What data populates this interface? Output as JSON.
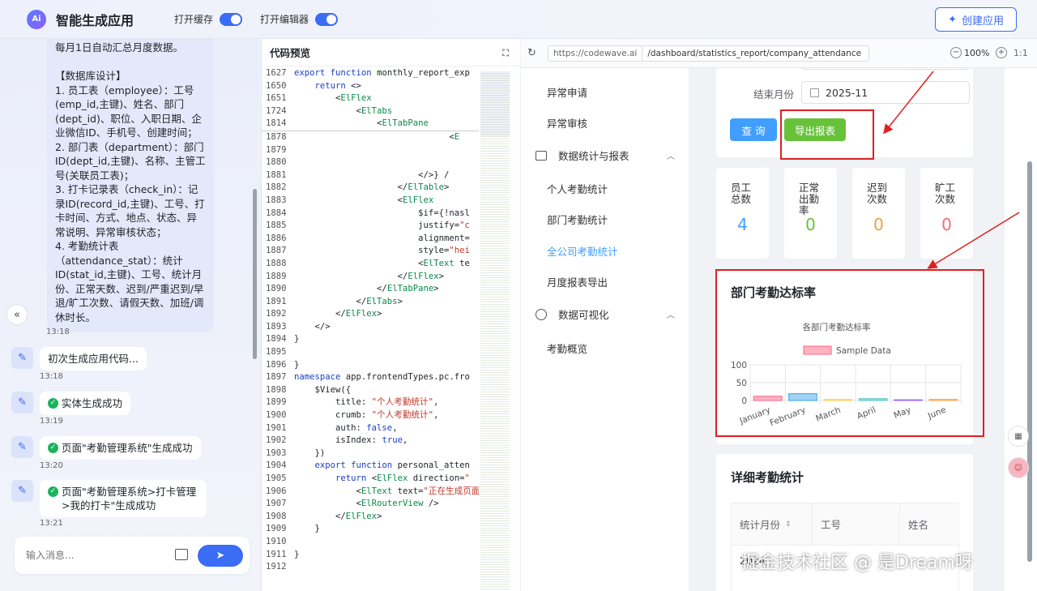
{
  "topbar": {
    "logo_text": "Ai",
    "app_title": "智能生成应用",
    "toggle_cache_label": "打开缓存",
    "toggle_editor_label": "打开编辑器",
    "create_button": "创建应用",
    "accent_color": "#3b6cf6"
  },
  "chat": {
    "first_message": {
      "lines": [
        "每月1日自动汇总月度数据。",
        "",
        "【数据库设计】",
        "1. 员工表（employee）：工号(emp_id,主键)、姓名、部门(dept_id)、职位、入职日期、企业微信ID、手机号、创建时间；",
        "2. 部门表（department）：部门ID(dept_id,主键)、名称、主管工号(关联员工表)；",
        "3. 打卡记录表（check_in）：记录ID(record_id,主键)、工号、打卡时间、方式、地点、状态、异常说明、异常审核状态；",
        "4. 考勤统计表（attendance_stat）：统计ID(stat_id,主键)、工号、统计月份、正常天数、迟到/严重迟到/早退/旷工次数、请假天数、加班/调休时长。"
      ],
      "time": "13:18"
    },
    "logs": [
      {
        "text": "初次生成应用代码...",
        "success": false,
        "time": "13:18"
      },
      {
        "text": "实体生成成功",
        "success": true,
        "time": "13:19"
      },
      {
        "text": "页面\"考勤管理系统\"生成成功",
        "success": true,
        "time": "13:20"
      },
      {
        "text": "页面\"考勤管理系统>打卡管理>我的打卡\"生成成功",
        "success": true,
        "time": "13:21"
      }
    ],
    "input_placeholder": "输入消息..."
  },
  "code": {
    "header": "代码预览",
    "sticky_lines": [
      {
        "n": "1627",
        "segs": [
          [
            "kw",
            "export function "
          ],
          [
            "t",
            "monthly_report_exp"
          ]
        ]
      },
      {
        "n": "1650",
        "segs": [
          [
            "t",
            "    "
          ],
          [
            "kw",
            "return "
          ],
          [
            "t",
            "<>"
          ]
        ]
      },
      {
        "n": "1651",
        "segs": [
          [
            "t",
            "        <"
          ],
          [
            "tag",
            "ElFlex"
          ]
        ]
      },
      {
        "n": "1724",
        "segs": [
          [
            "t",
            "            <"
          ],
          [
            "tag",
            "ElTabs"
          ]
        ]
      },
      {
        "n": "1814",
        "segs": [
          [
            "t",
            "                <"
          ],
          [
            "tag",
            "ElTabPane"
          ]
        ]
      }
    ],
    "lines": [
      {
        "n": "1878",
        "segs": [
          [
            "t",
            "                              <"
          ],
          [
            "tag",
            "E"
          ]
        ]
      },
      {
        "n": "1879",
        "segs": [
          [
            "t",
            ""
          ]
        ]
      },
      {
        "n": "1880",
        "segs": [
          [
            "t",
            ""
          ]
        ]
      },
      {
        "n": "1881",
        "segs": [
          [
            "t",
            "                        </>} /"
          ]
        ]
      },
      {
        "n": "1882",
        "segs": [
          [
            "t",
            "                    </"
          ],
          [
            "tag",
            "ElTable"
          ],
          [
            "t",
            ">"
          ]
        ]
      },
      {
        "n": "1883",
        "segs": [
          [
            "t",
            "                    <"
          ],
          [
            "tag",
            "ElFlex"
          ]
        ]
      },
      {
        "n": "1884",
        "segs": [
          [
            "t",
            "                        $if={!nasl"
          ]
        ]
      },
      {
        "n": "1885",
        "segs": [
          [
            "t",
            "                        justify="
          ],
          [
            "str",
            "\"c"
          ]
        ]
      },
      {
        "n": "1886",
        "segs": [
          [
            "t",
            "                        alignment="
          ]
        ]
      },
      {
        "n": "1887",
        "segs": [
          [
            "t",
            "                        style="
          ],
          [
            "str",
            "\"hei"
          ]
        ]
      },
      {
        "n": "1888",
        "segs": [
          [
            "t",
            "                        <"
          ],
          [
            "tag",
            "ElText"
          ],
          [
            "t",
            " te"
          ]
        ]
      },
      {
        "n": "1889",
        "segs": [
          [
            "t",
            "                    </"
          ],
          [
            "tag",
            "ElFlex"
          ],
          [
            "t",
            ">"
          ]
        ]
      },
      {
        "n": "1890",
        "segs": [
          [
            "t",
            "                </"
          ],
          [
            "tag",
            "ElTabPane"
          ],
          [
            "t",
            ">"
          ]
        ]
      },
      {
        "n": "1891",
        "segs": [
          [
            "t",
            "            </"
          ],
          [
            "tag",
            "ElTabs"
          ],
          [
            "t",
            ">"
          ]
        ]
      },
      {
        "n": "1892",
        "segs": [
          [
            "t",
            "        </"
          ],
          [
            "tag",
            "ElFlex"
          ],
          [
            "t",
            ">"
          ]
        ]
      },
      {
        "n": "1893",
        "segs": [
          [
            "t",
            "    </>"
          ]
        ]
      },
      {
        "n": "1894",
        "segs": [
          [
            "t",
            "}"
          ]
        ]
      },
      {
        "n": "1895",
        "segs": [
          [
            "t",
            ""
          ]
        ]
      },
      {
        "n": "1896",
        "segs": [
          [
            "t",
            "}"
          ]
        ]
      },
      {
        "n": "1897",
        "segs": [
          [
            "kw",
            "namespace "
          ],
          [
            "t",
            "app.frontendTypes.pc.fro"
          ]
        ]
      },
      {
        "n": "1898",
        "segs": [
          [
            "t",
            "    $View({"
          ]
        ]
      },
      {
        "n": "1899",
        "segs": [
          [
            "t",
            "        title: "
          ],
          [
            "str",
            "\"个人考勤统计\""
          ],
          [
            "t",
            ","
          ]
        ]
      },
      {
        "n": "1900",
        "segs": [
          [
            "t",
            "        crumb: "
          ],
          [
            "str",
            "\"个人考勤统计\""
          ],
          [
            "t",
            ","
          ]
        ]
      },
      {
        "n": "1901",
        "segs": [
          [
            "t",
            "        auth: "
          ],
          [
            "kw",
            "false"
          ],
          [
            "t",
            ","
          ]
        ]
      },
      {
        "n": "1902",
        "segs": [
          [
            "t",
            "        isIndex: "
          ],
          [
            "kw",
            "true"
          ],
          [
            "t",
            ","
          ]
        ]
      },
      {
        "n": "1903",
        "segs": [
          [
            "t",
            "    })"
          ]
        ]
      },
      {
        "n": "1904",
        "segs": [
          [
            "t",
            "    "
          ],
          [
            "kw",
            "export function "
          ],
          [
            "t",
            "personal_atten"
          ]
        ]
      },
      {
        "n": "1905",
        "segs": [
          [
            "t",
            "        "
          ],
          [
            "kw",
            "return "
          ],
          [
            "t",
            "<"
          ],
          [
            "tag",
            "ElFlex"
          ],
          [
            "t",
            " direction="
          ],
          [
            "str",
            "\""
          ]
        ]
      },
      {
        "n": "1906",
        "segs": [
          [
            "t",
            "            <"
          ],
          [
            "tag",
            "ElText"
          ],
          [
            "t",
            " text="
          ],
          [
            "str",
            "\"正在生成页面"
          ]
        ]
      },
      {
        "n": "1907",
        "segs": [
          [
            "t",
            "            <"
          ],
          [
            "tag",
            "ElRouterView"
          ],
          [
            "t",
            " />"
          ]
        ]
      },
      {
        "n": "1908",
        "segs": [
          [
            "t",
            "        </"
          ],
          [
            "tag",
            "ElFlex"
          ],
          [
            "t",
            ">"
          ]
        ]
      },
      {
        "n": "1909",
        "segs": [
          [
            "t",
            "    }"
          ]
        ]
      },
      {
        "n": "1910",
        "segs": [
          [
            "t",
            ""
          ]
        ]
      },
      {
        "n": "1911",
        "segs": [
          [
            "t",
            "}"
          ]
        ]
      },
      {
        "n": "1912",
        "segs": [
          [
            "t",
            ""
          ]
        ]
      }
    ]
  },
  "preview": {
    "url_origin": "https://codewave.ai",
    "url_path": "/dashboard/statistics_report/company_attendance",
    "zoom": "100%",
    "ratio": "1:1",
    "nav": {
      "items_top": [
        "异常申请",
        "异常审核"
      ],
      "group_stats": "数据统计与报表",
      "stats_items": [
        "个人考勤统计",
        "部门考勤统计",
        "全公司考勤统计",
        "月度报表导出"
      ],
      "group_vis": "数据可视化",
      "vis_items": [
        "考勤概览"
      ]
    },
    "filter": {
      "end_month_label": "结束月份",
      "end_month_value": "2025-11",
      "query_button": "查 询",
      "export_button": "导出报表"
    },
    "stats": [
      {
        "label": "员工总数",
        "value": "4",
        "color": "#409eff"
      },
      {
        "label": "正常出勤率",
        "value": "0",
        "color": "#67c23a"
      },
      {
        "label": "迟到次数",
        "value": "0",
        "color": "#e6a23c"
      },
      {
        "label": "旷工次数",
        "value": "0",
        "color": "#f56c6c"
      }
    ],
    "dept_rate_title": "部门考勤达标率",
    "detail_title": "详细考勤统计",
    "table_headers": [
      "统计月份",
      "工号",
      "姓名"
    ],
    "table_first_cell": "2024"
  },
  "chart_data": {
    "type": "bar",
    "title": "各部门考勤达标率",
    "categories": [
      "January",
      "February",
      "March",
      "April",
      "May",
      "June"
    ],
    "series": [
      {
        "name": "Sample Data",
        "values": [
          12,
          19,
          3,
          5,
          2,
          3
        ]
      }
    ],
    "bar_colors": [
      "#ffb3c1",
      "#9fd4f5",
      "#ffe2a6",
      "#a8dede",
      "#cbb7f7",
      "#ffd3a8"
    ],
    "bar_border_colors": [
      "#ff6384",
      "#36a2eb",
      "#ffce56",
      "#4bc0c0",
      "#9966ff",
      "#ff9f40"
    ],
    "yticks": [
      100,
      50,
      0
    ],
    "ylim": [
      0,
      100
    ],
    "legend": "top"
  },
  "watermark": "掘金技术社区 @ 是Dream呀"
}
